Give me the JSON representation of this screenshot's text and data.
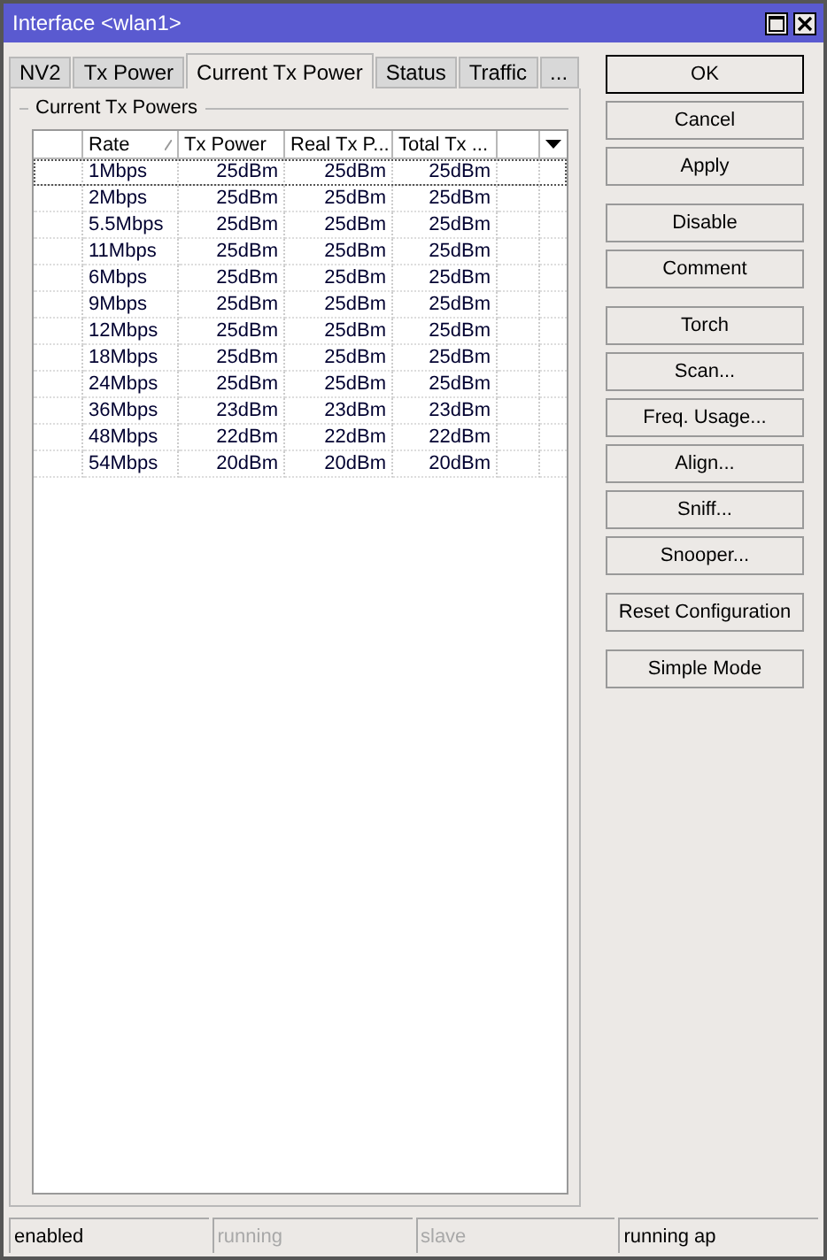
{
  "window": {
    "title": "Interface <wlan1>"
  },
  "tabs": [
    {
      "label": "NV2",
      "selected": false
    },
    {
      "label": "Tx Power",
      "selected": false
    },
    {
      "label": "Current Tx Power",
      "selected": true
    },
    {
      "label": "Status",
      "selected": false
    },
    {
      "label": "Traffic",
      "selected": false
    },
    {
      "label": "...",
      "selected": false
    }
  ],
  "group": {
    "title": "Current Tx Powers"
  },
  "table": {
    "columns": [
      {
        "label": "Rate",
        "sorted": true
      },
      {
        "label": "Tx Power",
        "sorted": false
      },
      {
        "label": "Real Tx P...",
        "sorted": false
      },
      {
        "label": "Total Tx ...",
        "sorted": false
      }
    ],
    "rows": [
      {
        "cells": [
          "1Mbps",
          "25dBm",
          "25dBm",
          "25dBm"
        ],
        "selected": true
      },
      {
        "cells": [
          "2Mbps",
          "25dBm",
          "25dBm",
          "25dBm"
        ],
        "selected": false
      },
      {
        "cells": [
          "5.5Mbps",
          "25dBm",
          "25dBm",
          "25dBm"
        ],
        "selected": false
      },
      {
        "cells": [
          "11Mbps",
          "25dBm",
          "25dBm",
          "25dBm"
        ],
        "selected": false
      },
      {
        "cells": [
          "6Mbps",
          "25dBm",
          "25dBm",
          "25dBm"
        ],
        "selected": false
      },
      {
        "cells": [
          "9Mbps",
          "25dBm",
          "25dBm",
          "25dBm"
        ],
        "selected": false
      },
      {
        "cells": [
          "12Mbps",
          "25dBm",
          "25dBm",
          "25dBm"
        ],
        "selected": false
      },
      {
        "cells": [
          "18Mbps",
          "25dBm",
          "25dBm",
          "25dBm"
        ],
        "selected": false
      },
      {
        "cells": [
          "24Mbps",
          "25dBm",
          "25dBm",
          "25dBm"
        ],
        "selected": false
      },
      {
        "cells": [
          "36Mbps",
          "23dBm",
          "23dBm",
          "23dBm"
        ],
        "selected": false
      },
      {
        "cells": [
          "48Mbps",
          "22dBm",
          "22dBm",
          "22dBm"
        ],
        "selected": false
      },
      {
        "cells": [
          "54Mbps",
          "20dBm",
          "20dBm",
          "20dBm"
        ],
        "selected": false
      }
    ]
  },
  "button_groups": [
    [
      {
        "label": "OK",
        "default": true
      },
      {
        "label": "Cancel",
        "default": false
      },
      {
        "label": "Apply",
        "default": false
      }
    ],
    [
      {
        "label": "Disable",
        "default": false
      },
      {
        "label": "Comment",
        "default": false
      }
    ],
    [
      {
        "label": "Torch",
        "default": false
      },
      {
        "label": "Scan...",
        "default": false
      },
      {
        "label": "Freq. Usage...",
        "default": false
      },
      {
        "label": "Align...",
        "default": false
      },
      {
        "label": "Sniff...",
        "default": false
      },
      {
        "label": "Snooper...",
        "default": false
      }
    ],
    [
      {
        "label": "Reset Configuration",
        "default": false
      }
    ],
    [
      {
        "label": "Simple Mode",
        "default": false
      }
    ]
  ],
  "status_bar": [
    {
      "text": "enabled",
      "disabled": false
    },
    {
      "text": "running",
      "disabled": true
    },
    {
      "text": "slave",
      "disabled": true
    },
    {
      "text": "running ap",
      "disabled": false
    }
  ]
}
